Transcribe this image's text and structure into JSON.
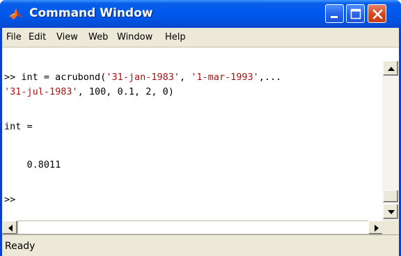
{
  "window": {
    "title": "Command Window",
    "icon": "matlab-logo-icon"
  },
  "menu": [
    {
      "label": "File"
    },
    {
      "label": "Edit"
    },
    {
      "label": "View"
    },
    {
      "label": "Web"
    },
    {
      "label": "Window"
    },
    {
      "label": "Help"
    }
  ],
  "console": {
    "line1_prefix": ">> int = acrubond(",
    "line1_str1": "'31-jan-1983'",
    "line1_sep": ", ",
    "line1_str2": "'1-mar-1993'",
    "line1_cont": ",...",
    "line2_str": "'31-jul-1983'",
    "line2_rest": ", 100, 0.1, 2, 0)",
    "result_label": "int =",
    "result_value": "    0.8011",
    "prompt": ">>"
  },
  "status": {
    "text": "Ready"
  },
  "colors": {
    "title_bar": "#0054e3",
    "close_button": "#d8471f",
    "string_literal": "#b01010"
  }
}
